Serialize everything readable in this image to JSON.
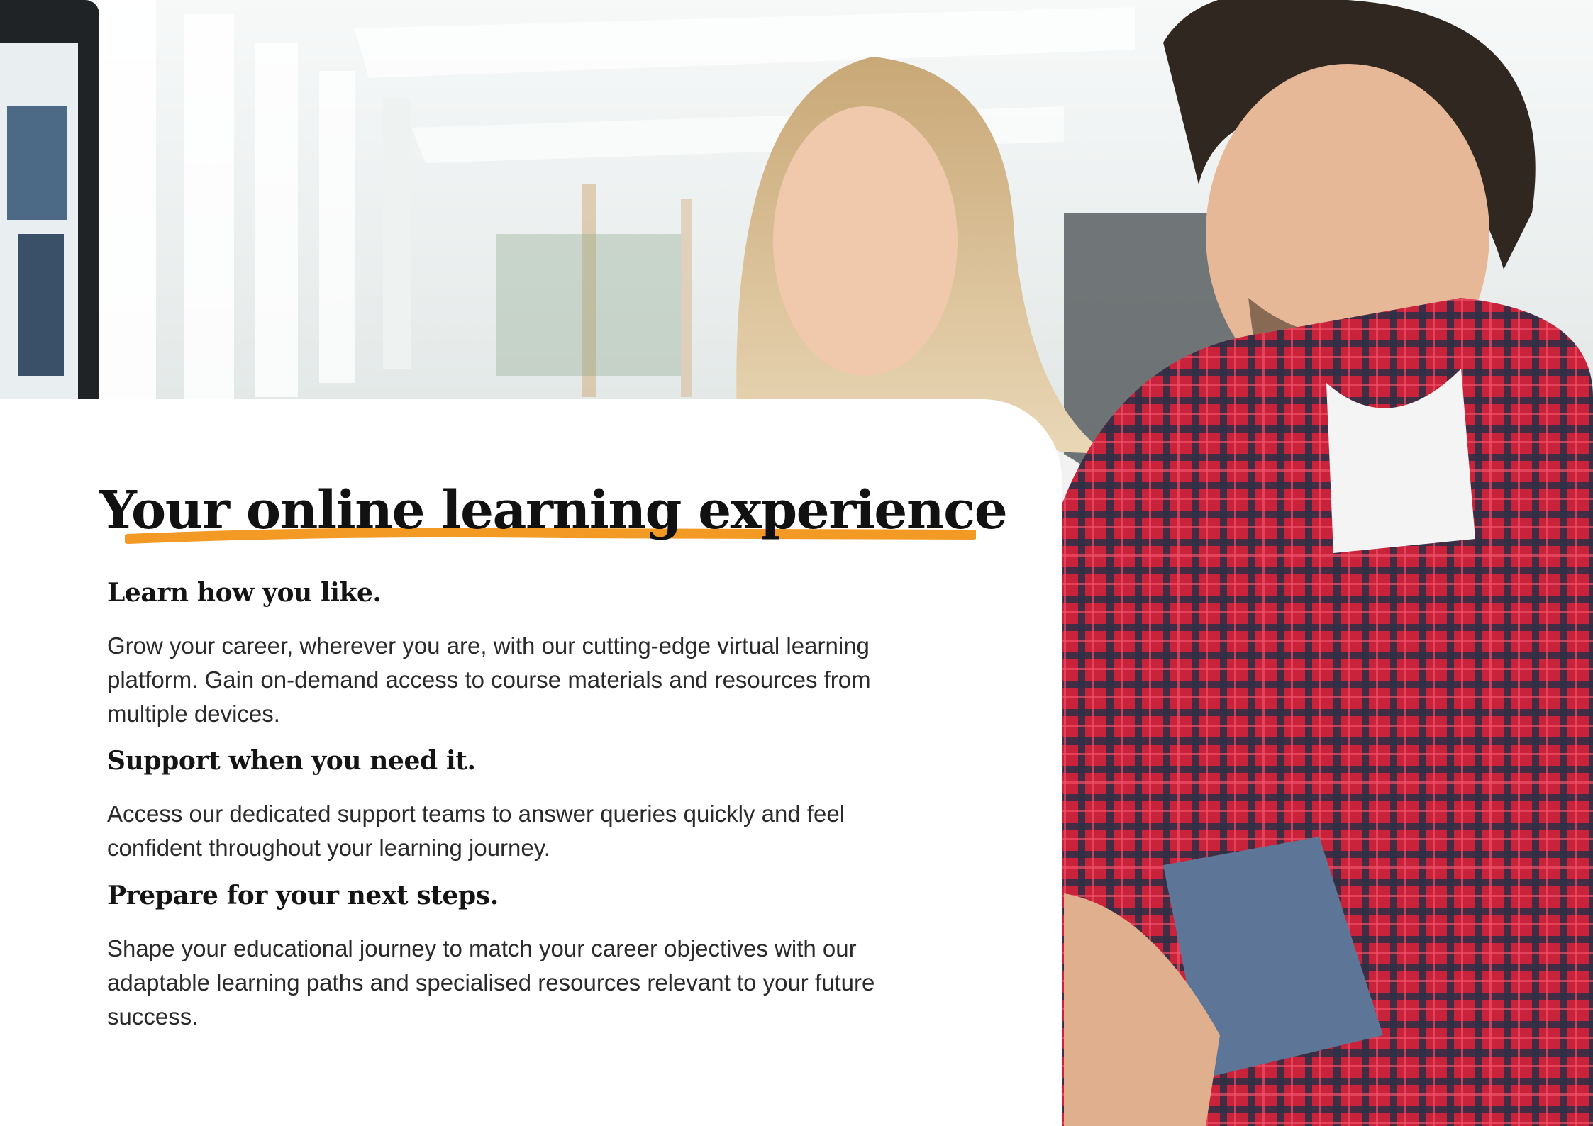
{
  "colors": {
    "accent_underline": "#f39a25",
    "card_background": "#ffffff",
    "heading_text": "#111111",
    "body_text": "#2a2a2a"
  },
  "hero": {
    "image_subject": "two-people-at-computer-photo"
  },
  "content": {
    "headline": "Your online learning experience",
    "sections": [
      {
        "heading": "Learn how you like.",
        "body": "Grow your career, wherever you are, with our cutting-edge virtual learning platform. Gain on-demand access to course materials and resources from multiple devices."
      },
      {
        "heading": "Support when you need it.",
        "body": "Access our dedicated support teams to answer queries quickly and feel confident throughout your learning journey."
      },
      {
        "heading": "Prepare for your next steps.",
        "body": "Shape your educational journey to match your career objectives with our adaptable learning paths and specialised resources relevant to your future success."
      }
    ]
  }
}
